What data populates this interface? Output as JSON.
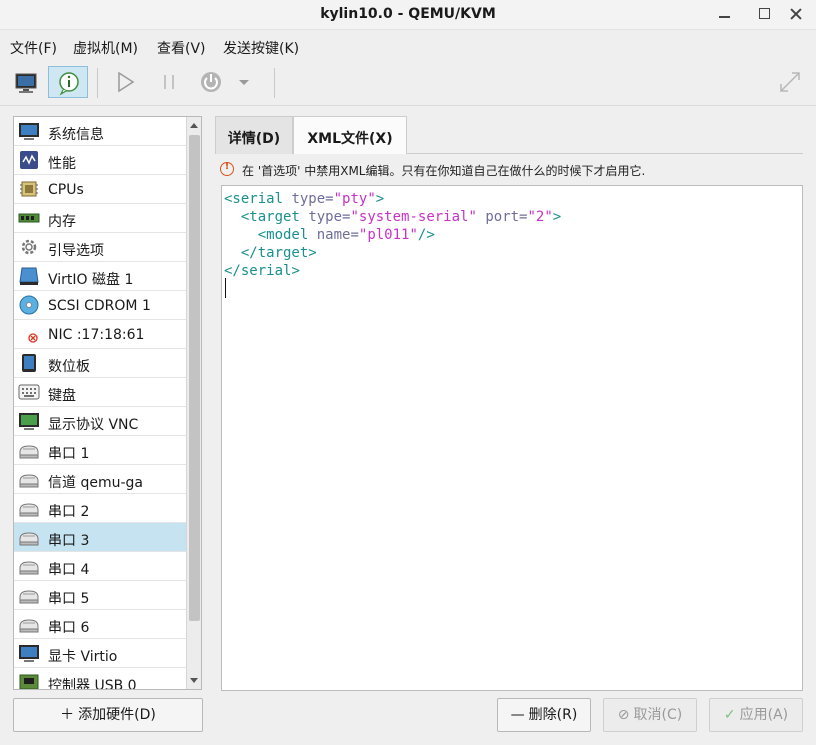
{
  "window": {
    "title": "kylin10.0 - QEMU/KVM"
  },
  "menu": {
    "items": [
      "文件(F)",
      "虚拟机(M)",
      "查看(V)",
      "发送按键(K)"
    ]
  },
  "toolbar": {
    "buttons": [
      "monitor-icon",
      "info-icon",
      "play-icon",
      "pause-icon",
      "power-icon",
      "dropdown-arrow-icon",
      "fullscreen-icon"
    ]
  },
  "hardware_list": {
    "items": [
      {
        "label": "系统信息",
        "icon": "monitor-icon"
      },
      {
        "label": "性能",
        "icon": "performance-icon"
      },
      {
        "label": "CPUs",
        "icon": "cpu-icon"
      },
      {
        "label": "内存",
        "icon": "memory-icon"
      },
      {
        "label": "引导选项",
        "icon": "gear-icon"
      },
      {
        "label": "VirtIO 磁盘 1",
        "icon": "disk-icon"
      },
      {
        "label": "SCSI CDROM 1",
        "icon": "cdrom-icon"
      },
      {
        "label": "NIC :17:18:61",
        "icon": "nic-disconnected-icon"
      },
      {
        "label": "数位板",
        "icon": "tablet-icon"
      },
      {
        "label": "键盘",
        "icon": "keyboard-icon"
      },
      {
        "label": "显示协议 VNC",
        "icon": "display-icon"
      },
      {
        "label": "串口 1",
        "icon": "serial-icon"
      },
      {
        "label": "信道 qemu-ga",
        "icon": "serial-icon"
      },
      {
        "label": "串口 2",
        "icon": "serial-icon"
      },
      {
        "label": "串口 3",
        "icon": "serial-icon"
      },
      {
        "label": "串口 4",
        "icon": "serial-icon"
      },
      {
        "label": "串口 5",
        "icon": "serial-icon"
      },
      {
        "label": "串口 6",
        "icon": "serial-icon"
      },
      {
        "label": "显卡 Virtio",
        "icon": "video-card-icon"
      },
      {
        "label": "控制器 USB 0",
        "icon": "controller-icon"
      }
    ],
    "selected_index": 14
  },
  "tabs": {
    "details": "详情(D)",
    "xml": "XML文件(X)",
    "active": "xml"
  },
  "warning": {
    "text": "在 '首选项' 中禁用XML编辑。只有在你知道自己在做什么的时候下才启用它."
  },
  "xml_lines": [
    "<serial type=\"pty\">",
    "  <target type=\"system-serial\" port=\"2\">",
    "    <model name=\"pl011\"/>",
    "  </target>",
    "</serial>"
  ],
  "buttons": {
    "add_hardware": "添加硬件(D)",
    "remove": "删除(R)",
    "cancel": "取消(C)",
    "apply": "应用(A)"
  }
}
